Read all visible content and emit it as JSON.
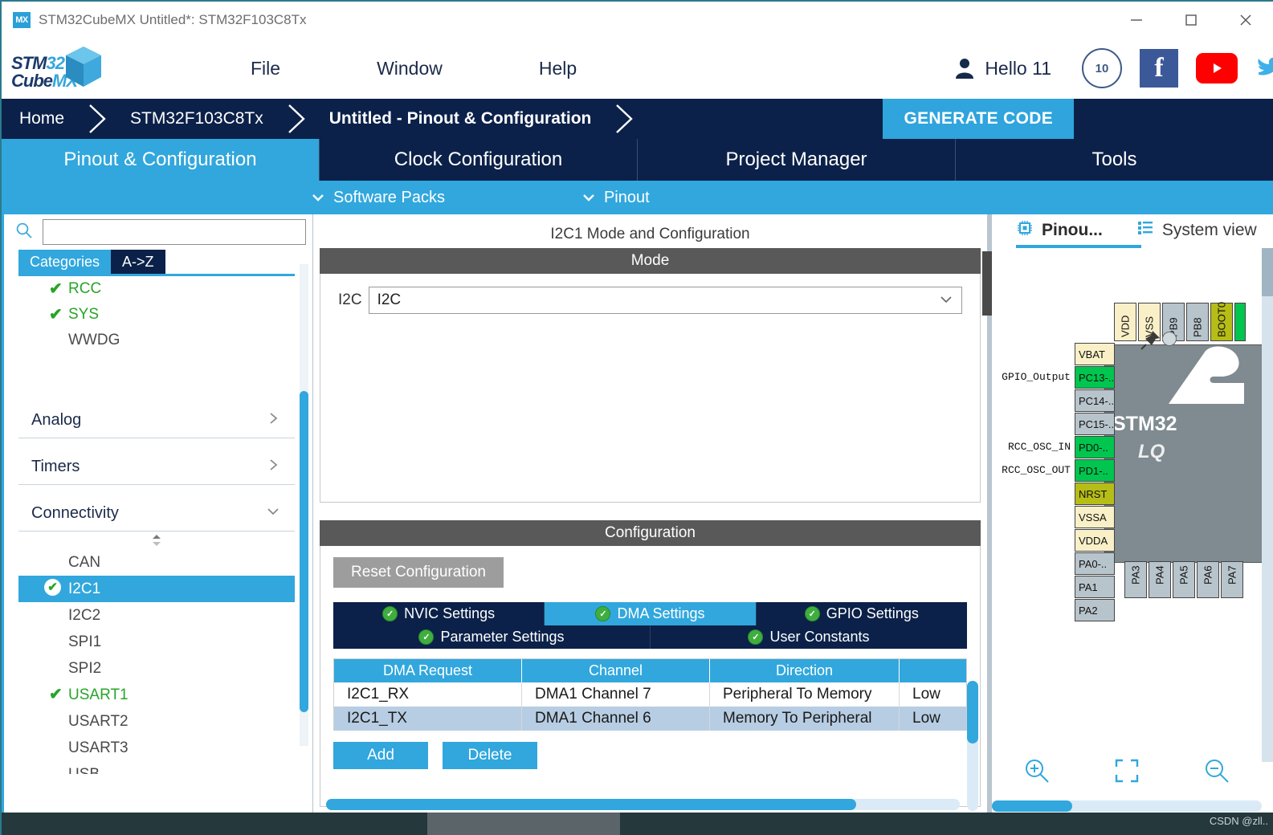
{
  "window": {
    "app_icon": "mx-icon",
    "title": "STM32CubeMX Untitled*: STM32F103C8Tx",
    "minimize": "minimize-icon",
    "maximize": "maximize-icon",
    "close": "close-icon"
  },
  "logo": {
    "line1_a": "STM",
    "line1_b": "32",
    "line2_a": "Cube",
    "line2_b": "MX"
  },
  "menu": {
    "items": [
      {
        "label": "File"
      },
      {
        "label": "Window"
      },
      {
        "label": "Help"
      }
    ],
    "user": "Hello 11",
    "badge": "10",
    "facebook": "f",
    "youtube": "youtube-icon",
    "twitter": "twitter-icon"
  },
  "breadcrumb": {
    "items": [
      {
        "label": "Home",
        "bold": false
      },
      {
        "label": "STM32F103C8Tx",
        "bold": false
      },
      {
        "label": "Untitled - Pinout & Configuration",
        "bold": true
      }
    ],
    "generate_code": "GENERATE CODE"
  },
  "main_tabs": [
    {
      "label": "Pinout & Configuration",
      "active": true
    },
    {
      "label": "Clock Configuration",
      "active": false
    },
    {
      "label": "Project Manager",
      "active": false
    },
    {
      "label": "Tools",
      "active": false
    }
  ],
  "sub_bar": {
    "software_packs": "Software Packs",
    "pinout": "Pinout"
  },
  "left_panel": {
    "search_placeholder": "",
    "search_value": "",
    "tabs": [
      {
        "label": "Categories",
        "active": true
      },
      {
        "label": "A->Z",
        "active": false
      }
    ],
    "top_items": [
      {
        "label": "RCC",
        "configured": true
      },
      {
        "label": "SYS",
        "configured": true
      },
      {
        "label": "WWDG",
        "configured": false
      }
    ],
    "groups": [
      {
        "label": "Analog",
        "expanded": false
      },
      {
        "label": "Timers",
        "expanded": false
      },
      {
        "label": "Connectivity",
        "expanded": true
      }
    ],
    "connectivity_items": [
      {
        "label": "CAN",
        "state": "none"
      },
      {
        "label": "I2C1",
        "state": "selected"
      },
      {
        "label": "I2C2",
        "state": "none"
      },
      {
        "label": "SPI1",
        "state": "none"
      },
      {
        "label": "SPI2",
        "state": "none"
      },
      {
        "label": "USART1",
        "state": "configured"
      },
      {
        "label": "USART2",
        "state": "none"
      },
      {
        "label": "USART3",
        "state": "none"
      },
      {
        "label": "USB",
        "state": "none"
      }
    ]
  },
  "center_panel": {
    "title": "I2C1 Mode and Configuration",
    "mode_band": "Mode",
    "mode_label": "I2C",
    "mode_value": "I2C",
    "config_band": "Configuration",
    "reset_button": "Reset Configuration",
    "config_tabs_row1": [
      {
        "label": "NVIC Settings",
        "active": false
      },
      {
        "label": "DMA Settings",
        "active": true
      },
      {
        "label": "GPIO Settings",
        "active": false
      }
    ],
    "config_tabs_row2": [
      {
        "label": "Parameter Settings",
        "active": false
      },
      {
        "label": "User Constants",
        "active": false
      }
    ],
    "dma_table": {
      "headers": [
        "DMA Request",
        "Channel",
        "Direction",
        ""
      ],
      "rows": [
        {
          "request": "I2C1_RX",
          "channel": "DMA1 Channel 7",
          "direction": "Peripheral To Memory",
          "priority": "Low"
        },
        {
          "request": "I2C1_TX",
          "channel": "DMA1 Channel 6",
          "direction": "Memory To Peripheral",
          "priority": "Low"
        }
      ]
    },
    "add_button": "Add",
    "delete_button": "Delete"
  },
  "right_panel": {
    "tabs": [
      {
        "label": "Pinou...",
        "icon": "chip-icon",
        "active": true
      },
      {
        "label": "System view",
        "icon": "list-icon",
        "active": false
      }
    ],
    "chip": {
      "name": "STM32",
      "sub": "LQ",
      "logo": "st-logo"
    },
    "pins_top": [
      {
        "label": "VDD",
        "type": "pwr"
      },
      {
        "label": "VSS",
        "type": "pwr"
      },
      {
        "label": "PB9",
        "type": "gpio"
      },
      {
        "label": "PB8",
        "type": "gpio"
      },
      {
        "label": "BOOT0",
        "type": "olive"
      },
      {
        "label": "",
        "type": "green"
      }
    ],
    "pins_left": [
      {
        "label": "VBAT",
        "type": "pwr",
        "signal": ""
      },
      {
        "label": "PC13-..",
        "type": "green",
        "signal": "GPIO_Output"
      },
      {
        "label": "PC14-..",
        "type": "gpio",
        "signal": ""
      },
      {
        "label": "PC15-..",
        "type": "gpio",
        "signal": ""
      },
      {
        "label": "PD0-..",
        "type": "green",
        "signal": "RCC_OSC_IN"
      },
      {
        "label": "PD1-..",
        "type": "green",
        "signal": "RCC_OSC_OUT"
      },
      {
        "label": "NRST",
        "type": "olive",
        "signal": ""
      },
      {
        "label": "VSSA",
        "type": "pwr",
        "signal": ""
      },
      {
        "label": "VDDA",
        "type": "pwr",
        "signal": ""
      },
      {
        "label": "PA0-..",
        "type": "gpio",
        "signal": ""
      },
      {
        "label": "PA1",
        "type": "gpio",
        "signal": ""
      },
      {
        "label": "PA2",
        "type": "gpio",
        "signal": ""
      }
    ],
    "pins_bottom": [
      {
        "label": "PA3",
        "type": "gpio"
      },
      {
        "label": "PA4",
        "type": "gpio"
      },
      {
        "label": "PA5",
        "type": "gpio"
      },
      {
        "label": "PA6",
        "type": "gpio"
      },
      {
        "label": "PA7",
        "type": "gpio"
      }
    ],
    "zoom_controls": [
      {
        "name": "zoom-in-icon"
      },
      {
        "name": "fit-screen-icon"
      },
      {
        "name": "zoom-out-icon"
      }
    ]
  },
  "taskbar": {
    "watermark": "CSDN @zll.."
  },
  "colors": {
    "accent_blue": "#31a7dd",
    "navy": "#0b2149",
    "band_gray": "#595959",
    "green_ok": "#28a428",
    "pin_power": "#faf0c8",
    "pin_gpio": "#b8c4cb",
    "pin_green": "#00c64f",
    "pin_olive": "#b7bd17"
  }
}
